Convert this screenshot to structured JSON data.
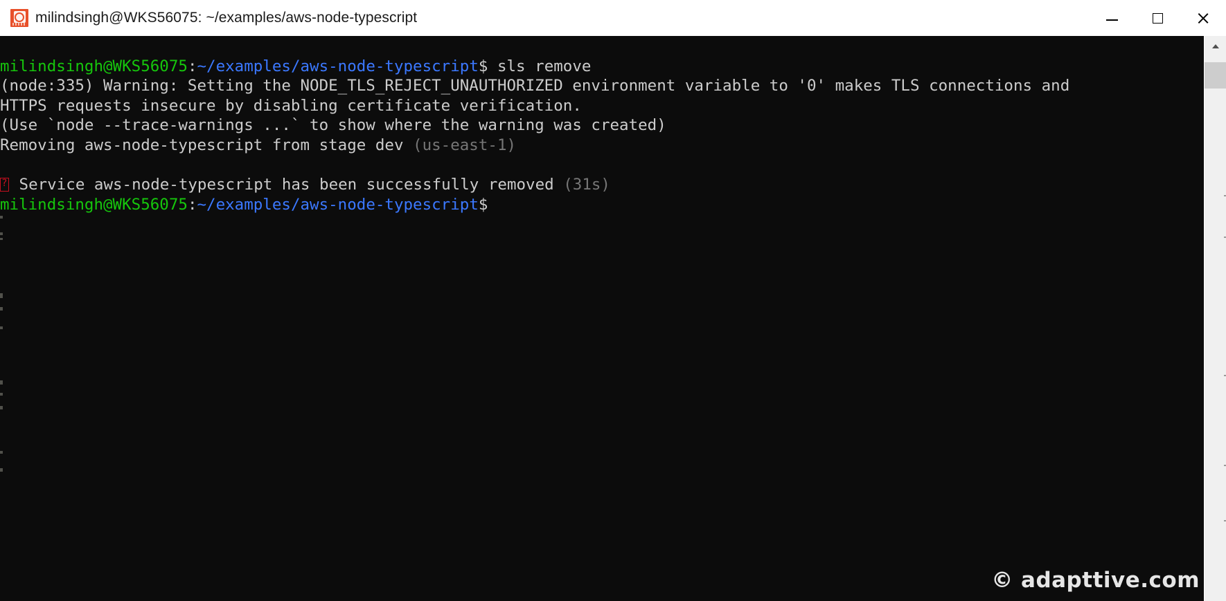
{
  "window": {
    "title": "milindsingh@WKS56075: ~/examples/aws-node-typescript",
    "icon": "terminal-app-icon",
    "controls": {
      "minimize": "minimize-icon",
      "maximize": "maximize-icon",
      "close": "close-icon"
    }
  },
  "terminal": {
    "background_color": "#0c0c0c",
    "prompt": {
      "user_host": "milindsingh@WKS56075",
      "separator": ":",
      "path": "~/examples/aws-node-typescript",
      "symbol": "$"
    },
    "colors": {
      "green": "#16c60c",
      "blue": "#3b78ff",
      "white": "#cccccc",
      "dim": "#767676",
      "red": "#c50f1f"
    },
    "command": "sls remove",
    "lines": {
      "warn_1a": "(node:335) Warning: Setting the NODE_TLS_REJECT_UNAUTHORIZED environment variable to '0' makes TLS connections and",
      "warn_1b": "HTTPS requests insecure by disabling certificate verification.",
      "warn_2": "(Use `node --trace-warnings ...` to show where the warning was created)",
      "removing": "Removing aws-node-typescript from stage dev ",
      "removing_region": "(us-east-1)",
      "success": " Service aws-node-typescript has been successfully removed ",
      "success_duration": "(31s)"
    }
  },
  "scrollbar": {
    "up_arrow": "scroll-up-icon",
    "down_arrow": "scroll-down-icon",
    "thumb": "scrollbar-thumb"
  },
  "watermark": {
    "text": "© adapttive.com"
  }
}
